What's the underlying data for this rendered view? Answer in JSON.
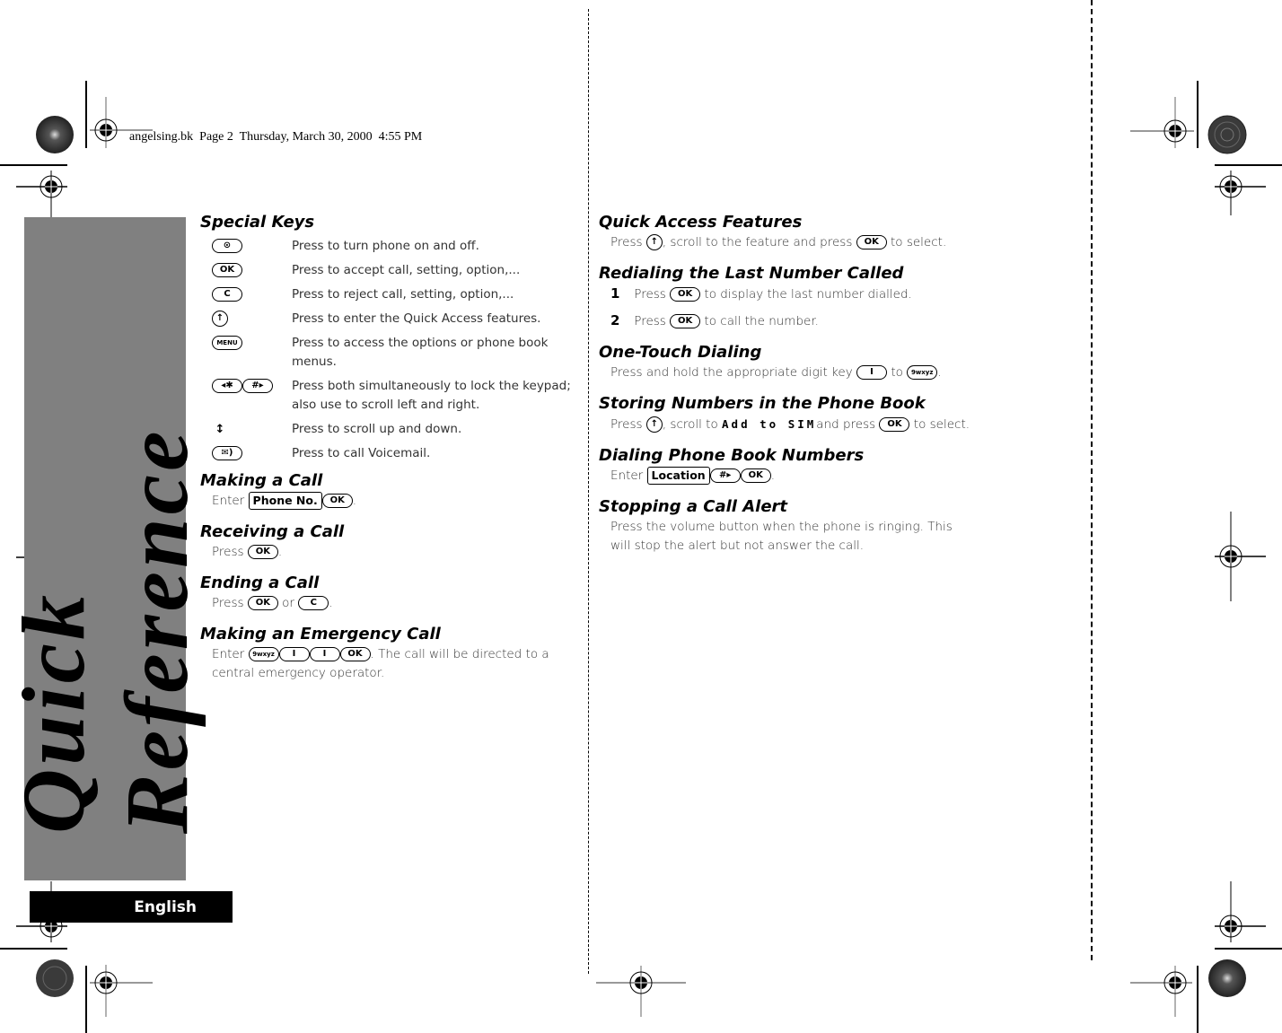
{
  "header": {
    "stamp": "angelsing.bk  Page 2  Thursday, March 30, 2000  4:55 PM"
  },
  "side": {
    "title": "Quick Reference",
    "language_tab": "English"
  },
  "left_column": {
    "special_keys": {
      "title": "Special Keys",
      "rows": [
        {
          "keys": [
            {
              "label": "⊙",
              "icon": "power-key-icon"
            }
          ],
          "text": "Press to turn phone on and off."
        },
        {
          "keys": [
            {
              "label": "OK",
              "icon": "ok-key-icon"
            }
          ],
          "text": "Press to accept call, setting, option,..."
        },
        {
          "keys": [
            {
              "label": "C",
              "icon": "clear-key-icon"
            }
          ],
          "text": "Press to reject call, setting, option,..."
        },
        {
          "keys": [
            {
              "label": "↑",
              "icon": "quick-access-key-icon"
            }
          ],
          "text": "Press to enter the Quick Access features."
        },
        {
          "keys": [
            {
              "label": "MENU",
              "icon": "menu-key-icon"
            }
          ],
          "text": "Press to access the options or phone book menus."
        },
        {
          "keys": [
            {
              "label": "◂✱",
              "icon": "star-key-icon"
            },
            {
              "label": "#▸",
              "icon": "hash-key-icon"
            }
          ],
          "text": "Press both simultaneously to lock the keypad; also use to scroll left and right."
        },
        {
          "keys": [
            {
              "label": "↕",
              "icon": "scroll-key-icon"
            }
          ],
          "text": "Press to scroll up and down."
        },
        {
          "keys": [
            {
              "label": "✉)",
              "icon": "voicemail-key-icon"
            }
          ],
          "text": "Press to call Voicemail."
        }
      ]
    },
    "making_call": {
      "title": "Making a Call",
      "prefix": "Enter",
      "box": "Phone No.",
      "ok": "OK",
      "suffix": "."
    },
    "receiving_call": {
      "title": "Receiving a Call",
      "prefix": "Press",
      "ok": "OK",
      "suffix": "."
    },
    "ending_call": {
      "title": "Ending a Call",
      "prefix": "Press",
      "ok": "OK",
      "or": "or",
      "c": "C",
      "suffix": "."
    },
    "emergency_call": {
      "title": "Making an Emergency Call",
      "prefix": "Enter",
      "k9": "9wxyz",
      "k1a": "I",
      "k1b": "I",
      "ok": "OK",
      "text": ". The call will be directed to a central emergency operator."
    }
  },
  "right_column": {
    "quick_access": {
      "title": "Quick Access Features",
      "prefix": "Press",
      "mid": ", scroll to the feature and press",
      "ok": "OK",
      "suffix": "to select."
    },
    "redialing": {
      "title": "Redialing the Last Number Called",
      "steps": [
        {
          "num": "1",
          "prefix": "Press",
          "ok": "OK",
          "text": "to display the last number dialled."
        },
        {
          "num": "2",
          "prefix": "Press",
          "ok": "OK",
          "text": "to call the number."
        }
      ]
    },
    "one_touch": {
      "title": "One-Touch Dialing",
      "prefix": "Press and hold the appropriate digit key",
      "k1": "I",
      "to": "to",
      "k9": "9wxyz",
      "suffix": "."
    },
    "storing": {
      "title": "Storing Numbers in the Phone Book",
      "prefix": "Press",
      "mid": ", scroll to",
      "menu_item": "Add to SIM",
      "mid2": "and press",
      "ok": "OK",
      "suffix": "to select."
    },
    "dialing_pb": {
      "title": "Dialing Phone Book Numbers",
      "prefix": "Enter",
      "box": "Location",
      "hash": "#▸",
      "ok": "OK",
      "suffix": "."
    },
    "stopping": {
      "title": "Stopping a Call Alert",
      "text": "Press the volume button when the phone is ringing. This will stop the alert but not answer the call."
    }
  }
}
